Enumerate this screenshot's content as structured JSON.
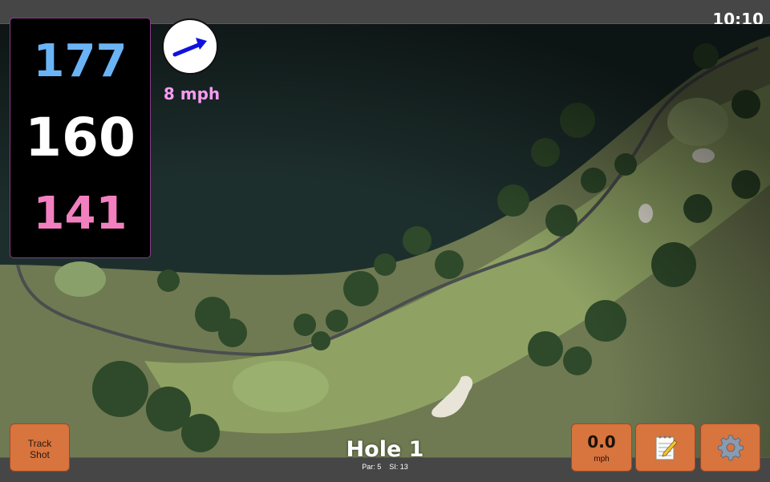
{
  "status_bar": {
    "time": "10:10"
  },
  "distances": {
    "back": "177",
    "middle": "160",
    "front": "141"
  },
  "wind": {
    "speed_label": "8 mph",
    "direction_icon": "wind-arrow-icon"
  },
  "buttons": {
    "track_shot_line1": "Track",
    "track_shot_line2": "Shot",
    "speed_value": "0.0",
    "speed_unit": "mph",
    "notes_icon": "notepad-icon",
    "settings_icon": "gear-icon"
  },
  "hole": {
    "title": "Hole 1",
    "par_label": "Par: 5",
    "si_label": "SI: 13"
  },
  "colors": {
    "back": "#6ab4f5",
    "middle": "#ffffff",
    "front": "#f27fc0",
    "wind_text": "#f59bf0",
    "button": "#d8743e",
    "accent_border": "#8a3a8a"
  }
}
